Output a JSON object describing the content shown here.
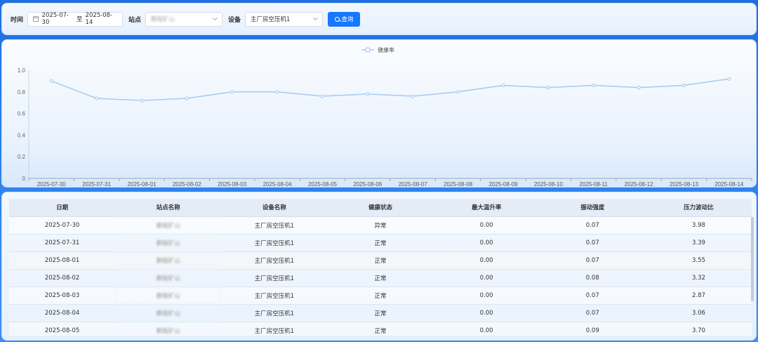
{
  "filter": {
    "time_label": "时间",
    "date_start": "2025-07-30",
    "date_sep": "至",
    "date_end": "2025-08-14",
    "station_label": "站点",
    "station_value": "鹏程矿山",
    "device_label": "设备",
    "device_value": "主厂房空压机1",
    "query_label": "查询",
    "icons": {
      "calendar": "calendar-icon",
      "search": "search-icon",
      "dropdown": "chevron-down-icon"
    },
    "accent": "#1677ff"
  },
  "chart_data": {
    "type": "line",
    "title": "",
    "xlabel": "",
    "ylabel": "",
    "legend": "top-center",
    "grid": false,
    "ylim": [
      0,
      1.0
    ],
    "yticks": [
      "0",
      "0.2",
      "0.4",
      "0.6",
      "0.8",
      "1.0"
    ],
    "categories": [
      "2025-07-30",
      "2025-07-31",
      "2025-08-01",
      "2025-08-02",
      "2025-08-03",
      "2025-08-04",
      "2025-08-05",
      "2025-08-06",
      "2025-08-07",
      "2025-08-08",
      "2025-08-09",
      "2025-08-10",
      "2025-08-11",
      "2025-08-12",
      "2025-08-13",
      "2025-08-14"
    ],
    "series": [
      {
        "name": "健康率",
        "color": "#a9cdf0",
        "values": [
          0.9,
          0.74,
          0.72,
          0.74,
          0.8,
          0.8,
          0.76,
          0.78,
          0.76,
          0.8,
          0.86,
          0.84,
          0.86,
          0.84,
          0.86,
          0.92
        ]
      }
    ]
  },
  "table": {
    "headers": [
      "日期",
      "站点名称",
      "设备名称",
      "健康状态",
      "最大温升率",
      "振动强度",
      "压力波动比"
    ],
    "rows": [
      [
        "2025-07-30",
        "鹏程矿山",
        "主厂房空压机1",
        "异常",
        "0.00",
        "0.07",
        "3.98"
      ],
      [
        "2025-07-31",
        "鹏程矿山",
        "主厂房空压机1",
        "正常",
        "0.00",
        "0.07",
        "3.39"
      ],
      [
        "2025-08-01",
        "鹏程矿山",
        "主厂房空压机1",
        "正常",
        "0.00",
        "0.07",
        "3.55"
      ],
      [
        "2025-08-02",
        "鹏程矿山",
        "主厂房空压机1",
        "正常",
        "0.00",
        "0.08",
        "3.32"
      ],
      [
        "2025-08-03",
        "鹏程矿山",
        "主厂房空压机1",
        "正常",
        "0.00",
        "0.07",
        "2.87"
      ],
      [
        "2025-08-04",
        "鹏程矿山",
        "主厂房空压机1",
        "正常",
        "0.00",
        "0.07",
        "3.06"
      ],
      [
        "2025-08-05",
        "鹏程矿山",
        "主厂房空压机1",
        "正常",
        "0.00",
        "0.09",
        "3.70"
      ]
    ],
    "highlighted_row": 2
  }
}
